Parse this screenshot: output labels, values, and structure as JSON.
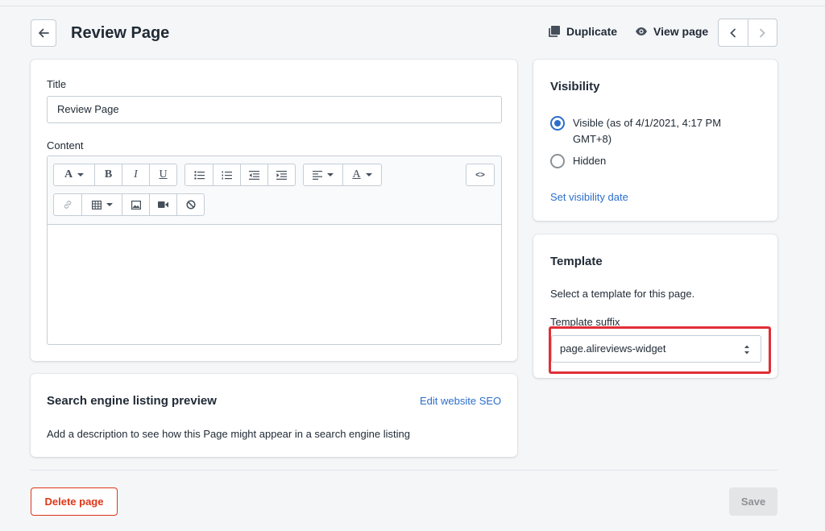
{
  "header": {
    "title": "Review Page",
    "duplicate_label": "Duplicate",
    "view_page_label": "View page"
  },
  "main": {
    "title_label": "Title",
    "title_value": "Review Page",
    "content_label": "Content",
    "toolbar": {
      "font_letter": "A",
      "bold": "B",
      "italic": "I",
      "underline": "U",
      "color_letter": "A",
      "code": "<>"
    }
  },
  "seo": {
    "title": "Search engine listing preview",
    "edit_link": "Edit website SEO",
    "description": "Add a description to see how this Page might appear in a search engine listing"
  },
  "visibility": {
    "title": "Visibility",
    "visible_label": "Visible (as of 4/1/2021, 4:17 PM",
    "visible_label_2": "GMT+8)",
    "hidden_label": "Hidden",
    "set_date_link": "Set visibility date"
  },
  "template": {
    "title": "Template",
    "description": "Select a template for this page.",
    "suffix_label": "Template suffix",
    "selected": "page.alireviews-widget"
  },
  "footer": {
    "delete_label": "Delete page",
    "save_label": "Save"
  },
  "colors": {
    "accent": "#2c6ecb",
    "danger": "#de3618",
    "highlight": "#e02f36"
  }
}
